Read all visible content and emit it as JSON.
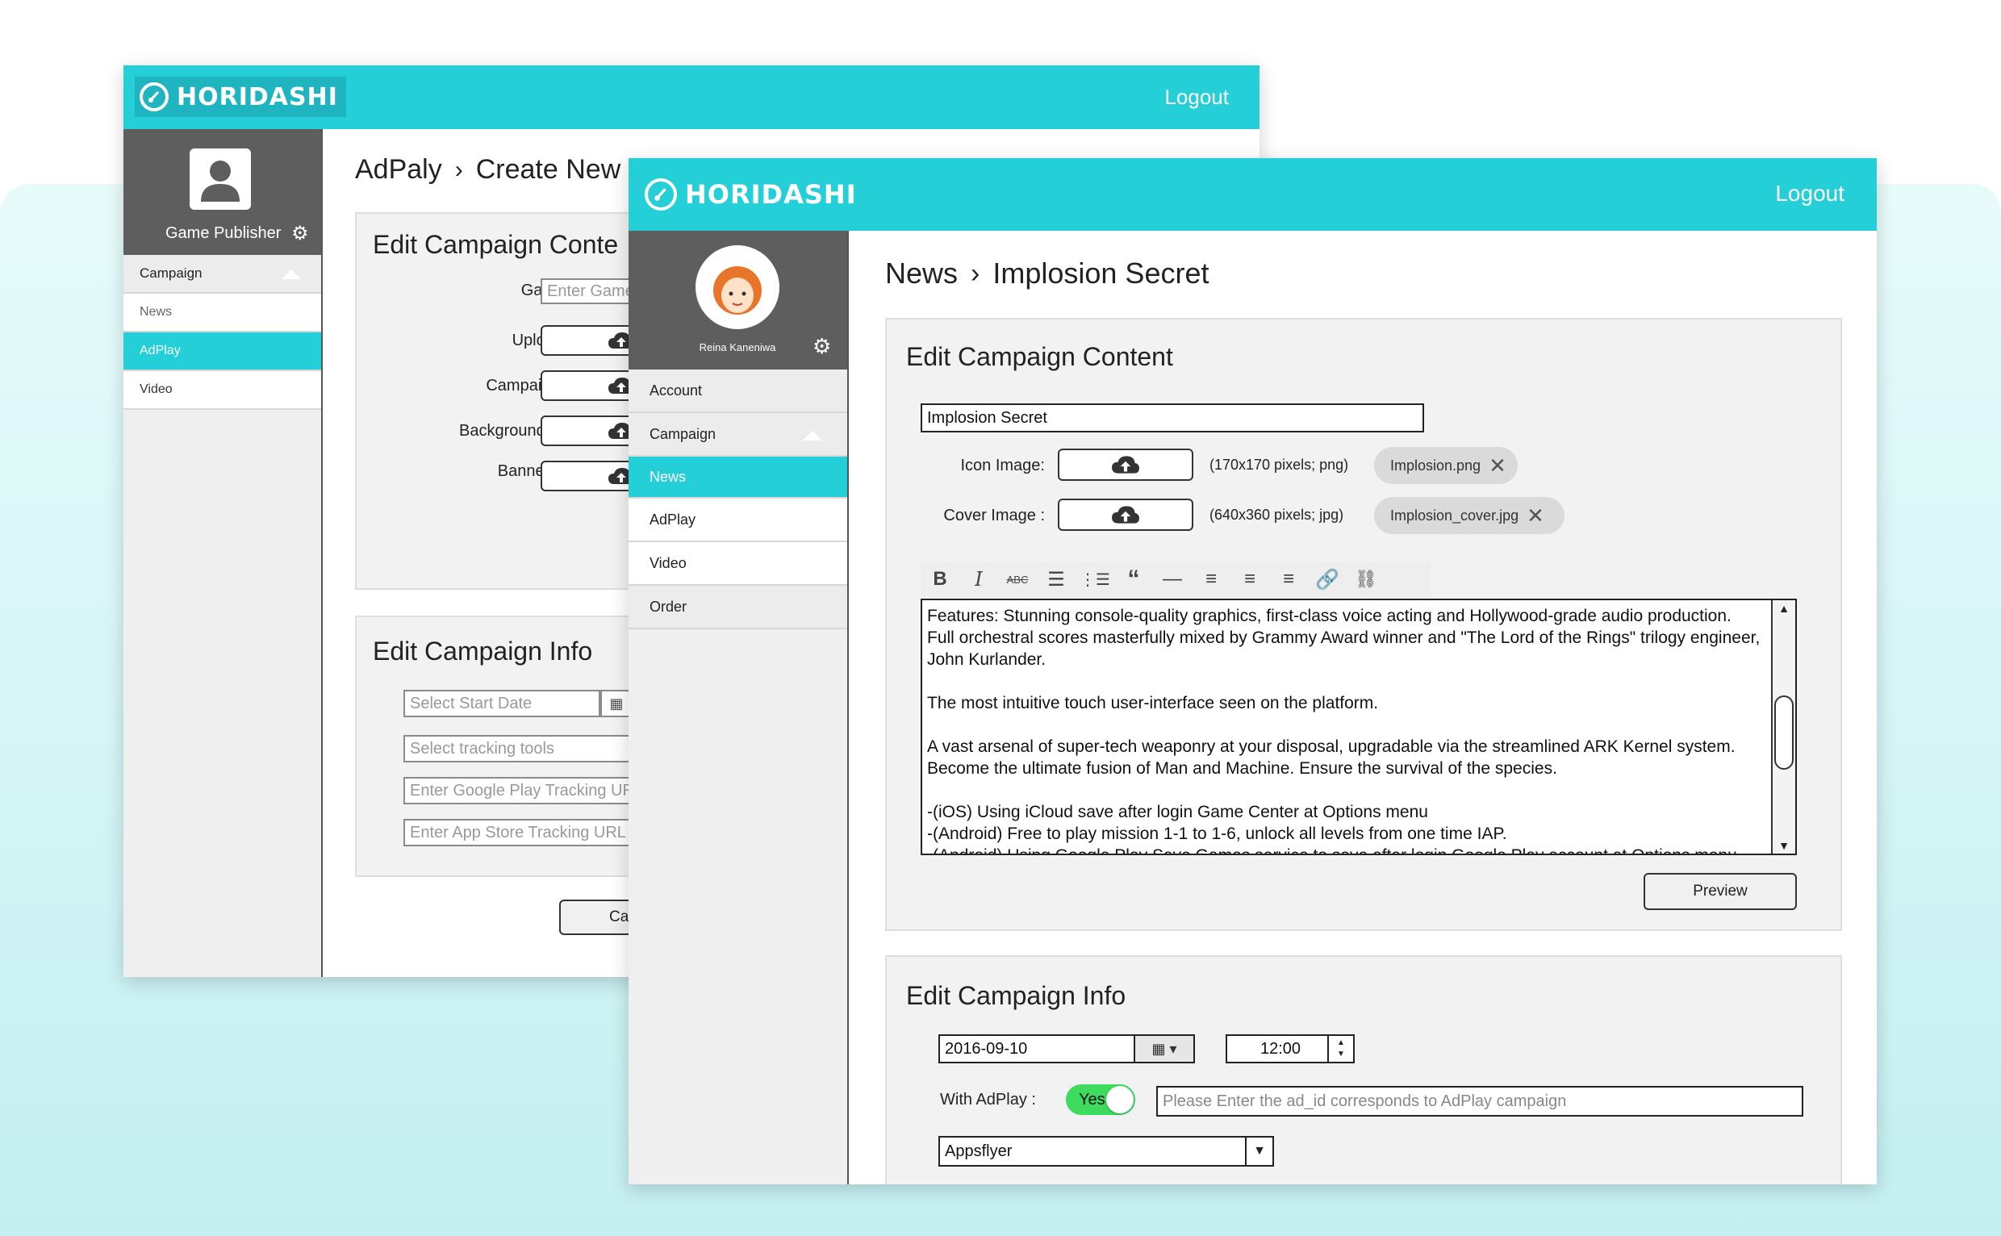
{
  "brand": {
    "name": "HORIDASHI"
  },
  "back_window": {
    "logout_label": "Logout",
    "profile_role": "Game Publisher",
    "sidebar_items": [
      "Campaign",
      "News",
      "AdPlay",
      "Video"
    ],
    "breadcrumb": {
      "parent": "AdPaly",
      "current": "Create New C"
    },
    "content_panel": {
      "title": "Edit Campaign Conte",
      "labels": {
        "game_title": "Game Title:",
        "upload_apk": "Upload APK:",
        "campaign_icon": "Campaign Icon :",
        "background_image": "Background Image :",
        "banner_image": "Banner Image:"
      },
      "game_title_placeholder": "Enter Game"
    },
    "info_panel": {
      "title": "Edit Campaign Info",
      "start_date_placeholder": "Select Start Date",
      "tracking_placeholder": "Select tracking tools",
      "google_url_placeholder": "Enter Google Play Tracking URL",
      "appstore_url_placeholder": "Enter App Store Tracking URL"
    },
    "cancel_button": "Car"
  },
  "front_window": {
    "logout_label": "Logout",
    "profile_name": "Reina Kaneniwa",
    "sidebar_items": [
      "Account",
      "Campaign",
      "News",
      "AdPlay",
      "Video",
      "Order"
    ],
    "breadcrumb": {
      "parent": "News",
      "current": "Implosion Secret"
    },
    "content_panel": {
      "title": "Edit Campaign Content",
      "campaign_title_value": "Implosion Secret",
      "icon_label": "Icon Image:",
      "icon_spec": "(170x170 pixels; png)",
      "icon_file": "Implosion.png",
      "cover_label": "Cover Image :",
      "cover_spec": "(640x360 pixels; jpg)",
      "cover_file": "Implosion_cover.jpg",
      "toolbar_icons": [
        "bold-icon",
        "italic-icon",
        "strikethrough-icon",
        "bullet-list-icon",
        "numbered-list-icon",
        "quote-icon",
        "horizontal-rule-icon",
        "align-left-icon",
        "align-center-icon",
        "align-right-icon",
        "link-icon",
        "unlink-icon"
      ],
      "editor_text": "Features: Stunning console-quality graphics, first-class voice acting and Hollywood-grade audio production.\nFull orchestral scores masterfully mixed by Grammy Award winner and \"The Lord of the Rings\" trilogy engineer, John Kurlander.\n\nThe most intuitive touch user-interface seen on the platform.\n\nA vast arsenal of super-tech weaponry at your disposal, upgradable via the streamlined ARK Kernel system. Become the ultimate fusion of Man and Machine. Ensure the survival of the species.\n\n-(iOS) Using iCloud save after login Game Center at Options menu\n-(Android) Free to play mission 1-1 to 1-6, unlock all levels from one time IAP.\n-(Android) Using Google Play Save Games service to save after login Google Play account at Options menu",
      "preview_button": "Preview"
    },
    "info_panel": {
      "title": "Edit Campaign Info",
      "date_value": "2016-09-10",
      "time_value": "12:00",
      "adplay_label": "With AdPlay :",
      "toggle_label": "Yes",
      "toggle_on": true,
      "ad_id_placeholder": "Please Enter the ad_id corresponds to AdPlay campaign",
      "tracking_value": "Appsflyer"
    }
  },
  "colors": {
    "accent": "#24cfd8",
    "sidebar_dark": "#5e5e5e",
    "toggle_green": "#3ddc5f"
  }
}
